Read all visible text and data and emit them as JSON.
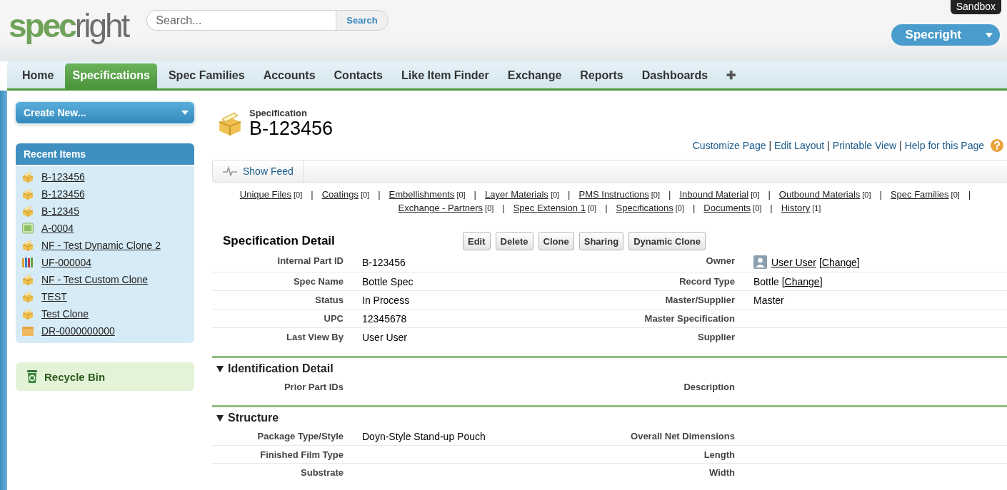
{
  "header": {
    "logo": {
      "part_1": "spec",
      "part_2": "right"
    },
    "search": {
      "placeholder": "Search...",
      "button": "Search"
    },
    "sandbox_badge": "Sandbox",
    "app_menu": "Specright"
  },
  "tabs": [
    {
      "label": "Home",
      "selected": false
    },
    {
      "label": "Specifications",
      "selected": true
    },
    {
      "label": "Spec Families",
      "selected": false
    },
    {
      "label": "Accounts",
      "selected": false
    },
    {
      "label": "Contacts",
      "selected": false
    },
    {
      "label": "Like Item Finder",
      "selected": false
    },
    {
      "label": "Exchange",
      "selected": false
    },
    {
      "label": "Reports",
      "selected": false
    },
    {
      "label": "Dashboards",
      "selected": false
    },
    {
      "label": "✚",
      "selected": false
    }
  ],
  "sidebar": {
    "create_new": "Create New...",
    "recent_items": {
      "title": "Recent Items",
      "items": [
        {
          "label": "B-123456",
          "kind": "spec"
        },
        {
          "label": "B-123456",
          "kind": "spec"
        },
        {
          "label": "B-12345",
          "kind": "spec"
        },
        {
          "label": "A-0004",
          "kind": "account"
        },
        {
          "label": "NF - Test Dynamic Clone 2",
          "kind": "spec"
        },
        {
          "label": "UF-000004",
          "kind": "files"
        },
        {
          "label": "NF - Test Custom Clone",
          "kind": "spec"
        },
        {
          "label": "TEST",
          "kind": "spec"
        },
        {
          "label": "Test Clone",
          "kind": "spec"
        },
        {
          "label": "DR-0000000000",
          "kind": "folder"
        }
      ]
    },
    "recycle_bin": "Recycle Bin"
  },
  "record": {
    "type": "Specification",
    "name": "B-123456",
    "page_links": [
      {
        "label": "Customize Page",
        "separator": "|"
      },
      {
        "label": "Edit Layout",
        "separator": "|"
      },
      {
        "label": "Printable View",
        "separator": "|"
      },
      {
        "label": "Help for this Page"
      }
    ],
    "show_feed": "Show Feed",
    "related_lists": [
      {
        "label": "Unique Files",
        "count": "[0]",
        "separator": "|"
      },
      {
        "label": "Coatings",
        "count": "[0]",
        "separator": "|"
      },
      {
        "label": "Embellishments",
        "count": "[0]",
        "separator": "|"
      },
      {
        "label": "Layer Materials",
        "count": "[0]",
        "separator": "|"
      },
      {
        "label": "PMS Instructions",
        "count": "[0]",
        "separator": "|"
      },
      {
        "label": "Inbound Material",
        "count": "[0]",
        "separator": "|"
      },
      {
        "label": "Outbound Materials",
        "count": "[0]",
        "separator": "|"
      },
      {
        "label": "Spec Families",
        "count": "[0]",
        "separator": "|"
      },
      {
        "label": "Exchange - Partners",
        "count": "[0]",
        "separator": "|"
      },
      {
        "label": "Spec Extension 1",
        "count": "[0]",
        "separator": "|"
      },
      {
        "label": "Specifications",
        "count": "[0]",
        "separator": "|"
      },
      {
        "label": "Documents",
        "count": "[0]",
        "separator": "|"
      },
      {
        "label": "History",
        "count": "[1]"
      }
    ]
  },
  "detail": {
    "title": "Specification Detail",
    "buttons": [
      "Edit",
      "Delete",
      "Clone",
      "Sharing",
      "Dynamic Clone"
    ],
    "rows": [
      {
        "left_label": "Internal Part ID",
        "left_value": [
          {
            "kind": "text",
            "text": "B-123456"
          }
        ],
        "right_label": "Owner",
        "right_value": [
          {
            "kind": "avatar"
          },
          {
            "kind": "link",
            "text": "User User"
          },
          {
            "kind": "text",
            "text": " ["
          },
          {
            "kind": "link",
            "text": "Change"
          },
          {
            "kind": "text",
            "text": "]"
          }
        ]
      },
      {
        "left_label": "Spec Name",
        "left_value": [
          {
            "kind": "text",
            "text": "Bottle Spec"
          }
        ],
        "right_label": "Record Type",
        "right_value": [
          {
            "kind": "text",
            "text": "Bottle ["
          },
          {
            "kind": "link",
            "text": "Change"
          },
          {
            "kind": "text",
            "text": "]"
          }
        ]
      },
      {
        "left_label": "Status",
        "left_value": [
          {
            "kind": "text",
            "text": "In Process"
          }
        ],
        "right_label": "Master/Supplier",
        "right_value": [
          {
            "kind": "text",
            "text": "Master"
          }
        ]
      },
      {
        "left_label": "UPC",
        "left_value": [
          {
            "kind": "text",
            "text": "12345678"
          }
        ],
        "right_label": "Master Specification",
        "right_value": []
      },
      {
        "left_label": "Last View By",
        "left_value": [
          {
            "kind": "text",
            "text": "User User"
          }
        ],
        "right_label": "Supplier",
        "right_value": []
      }
    ]
  },
  "sections": [
    {
      "title": "Identification Detail",
      "expanded": true,
      "rows": [
        {
          "left_label": "Prior Part IDs",
          "left_value": [],
          "right_label": "Description",
          "right_value": []
        }
      ]
    },
    {
      "title": "Structure",
      "expanded": true,
      "rows": [
        {
          "left_label": "Package Type/Style",
          "left_value": [
            {
              "kind": "text",
              "text": "Doyn-Style Stand-up Pouch"
            }
          ],
          "right_label": "Overall Net Dimensions",
          "right_value": []
        },
        {
          "left_label": "Finished Film Type",
          "left_value": [],
          "right_label": "Length",
          "right_value": []
        },
        {
          "left_label": "Substrate",
          "left_value": [],
          "right_label": "Width",
          "right_value": []
        }
      ]
    }
  ]
}
